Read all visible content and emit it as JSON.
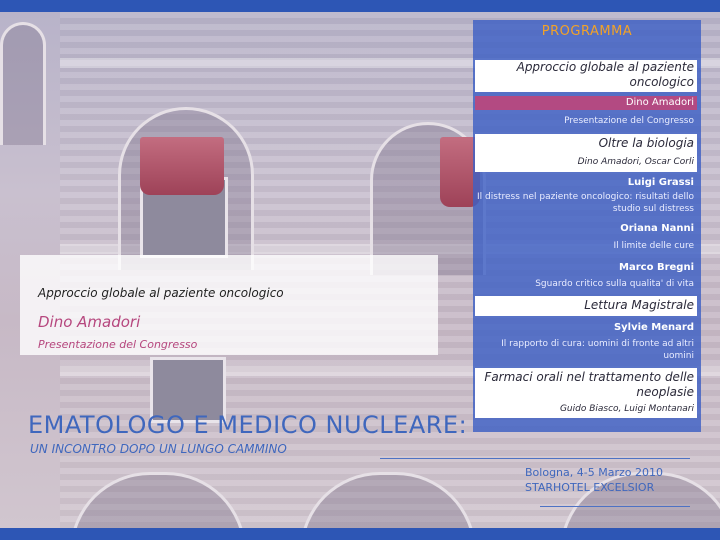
{
  "programma": {
    "title": "PROGRAMMA",
    "items": [
      {
        "title": "Approccio globale al paziente oncologico"
      },
      {
        "highlight": "Dino Amadori",
        "desc": "Presentazione del Congresso"
      },
      {
        "title": "Oltre la biologia",
        "sub": "Dino Amadori, Oscar Corli"
      },
      {
        "name": "Luigi Grassi",
        "desc": "Il distress nel paziente oncologico: risultati dello studio sul distress"
      },
      {
        "name": "Oriana Nanni",
        "desc": "Il limite delle cure"
      },
      {
        "name": "Marco Bregni",
        "desc": "Sguardo critico sulla qualita' di vita"
      },
      {
        "title": "Lettura Magistrale"
      },
      {
        "name": "Sylvie Menard",
        "desc": "Il rapporto di cura: uomini di fronte ad altri uomini"
      },
      {
        "title": "Farmaci orali nel trattamento delle neoplasie",
        "sub": "Guido Biasco, Luigi Montanari"
      }
    ]
  },
  "left_card": {
    "line1": "Approccio globale al paziente oncologico",
    "name": "Dino Amadori",
    "presentation": "Presentazione del Congresso"
  },
  "event": {
    "title": "EMATOLOGO E MEDICO NUCLEARE:",
    "subtitle": "UN INCONTRO DOPO UN LUNGO CAMMINO",
    "date": "Bologna, 4-5 Marzo 2010",
    "venue": "STARHOTEL EXCELSIOR"
  },
  "colors": {
    "accent_blue": "#3f67bd",
    "panel_blue": "#3e60c4",
    "highlight_magenta": "#b34a82",
    "orange_title": "#f2a228"
  }
}
